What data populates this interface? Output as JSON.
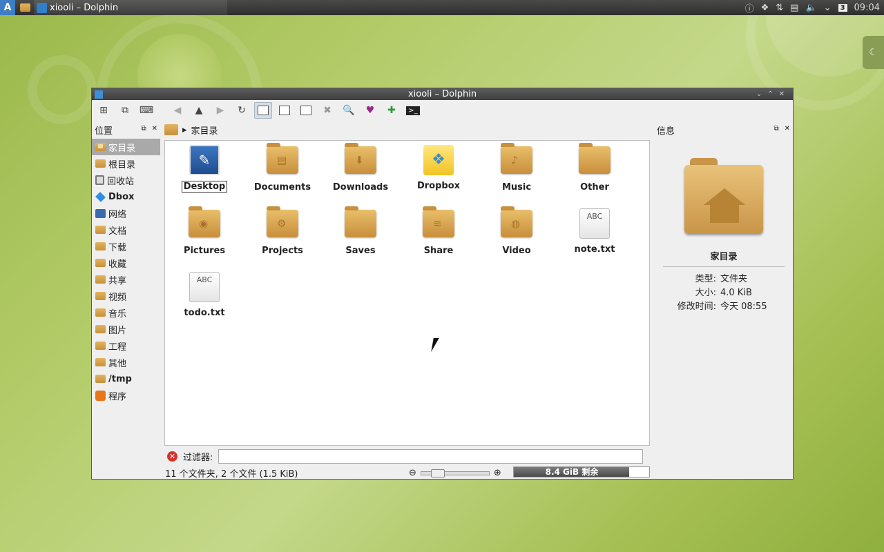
{
  "panel": {
    "launcher_glyph": "A",
    "task_title": "xiooli – Dolphin",
    "clock": "09:04",
    "workspace": "3"
  },
  "window": {
    "title": "xiooli – Dolphin"
  },
  "places": {
    "header": "位置",
    "items": [
      {
        "label": "家目录",
        "selected": true
      },
      {
        "label": "根目录"
      },
      {
        "label": "回收站"
      },
      {
        "label": "Dbox"
      },
      {
        "label": "网络"
      },
      {
        "label": "文档"
      },
      {
        "label": "下载"
      },
      {
        "label": "收藏"
      },
      {
        "label": "共享"
      },
      {
        "label": "视频"
      },
      {
        "label": "音乐"
      },
      {
        "label": "图片"
      },
      {
        "label": "工程"
      },
      {
        "label": "其他"
      },
      {
        "label": "/tmp"
      },
      {
        "label": "程序"
      }
    ]
  },
  "breadcrumb": {
    "current": "家目录"
  },
  "files": [
    {
      "label": "Desktop",
      "icon": "desktop-icon"
    },
    {
      "label": "Documents",
      "icon": "folder-documents-icon"
    },
    {
      "label": "Downloads",
      "icon": "folder-downloads-icon"
    },
    {
      "label": "Dropbox",
      "icon": "dropbox-icon"
    },
    {
      "label": "Music",
      "icon": "folder-music-icon"
    },
    {
      "label": "Other",
      "icon": "folder-icon"
    },
    {
      "label": "Pictures",
      "icon": "folder-pictures-icon"
    },
    {
      "label": "Projects",
      "icon": "folder-projects-icon"
    },
    {
      "label": "Saves",
      "icon": "folder-icon"
    },
    {
      "label": "Share",
      "icon": "folder-share-icon"
    },
    {
      "label": "Video",
      "icon": "folder-video-icon"
    },
    {
      "label": "note.txt",
      "icon": "text-file-icon"
    },
    {
      "label": "todo.txt",
      "icon": "text-file-icon"
    }
  ],
  "text_icon_label": "ABC",
  "filter": {
    "label": "过滤器:",
    "value": ""
  },
  "status": {
    "summary": "11 个文件夹, 2 个文件 (1.5 KiB)",
    "free_space": "8.4 GiB 剩余",
    "used_fraction": 0.85
  },
  "info": {
    "header": "信息",
    "name": "家目录",
    "type_label": "类型:",
    "type_value": "文件夹",
    "size_label": "大小:",
    "size_value": "4.0 KiB",
    "mtime_label": "修改时间:",
    "mtime_value": "今天 08:55"
  }
}
